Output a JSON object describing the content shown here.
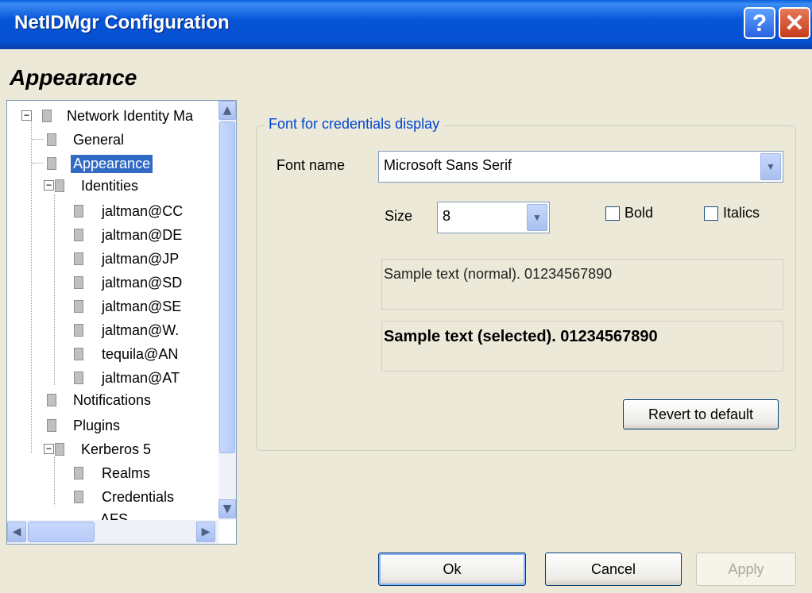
{
  "window": {
    "title": "NetIDMgr Configuration",
    "help_glyph": "?",
    "close_glyph": "✕"
  },
  "page_heading": "Appearance",
  "tree": {
    "root": "Network Identity Ma",
    "general": "General",
    "appearance": "Appearance",
    "identities": "Identities",
    "identity_items": [
      "jaltman@CC",
      "jaltman@DE",
      "jaltman@JP",
      "jaltman@SD",
      "jaltman@SE",
      "jaltman@W.",
      "tequila@AN",
      "jaltman@AT"
    ],
    "notifications": "Notifications",
    "plugins": "Plugins",
    "kerberos": "Kerberos 5",
    "realms": "Realms",
    "credentials": "Credentials",
    "afs_partial": "AFS",
    "selected": "Appearance"
  },
  "font_group": {
    "legend": "Font for credentials display",
    "font_name_label": "Font name",
    "font_name_value": "Microsoft Sans Serif",
    "size_label": "Size",
    "size_value": "8",
    "bold_label": "Bold",
    "bold_checked": false,
    "italics_label": "Italics",
    "italics_checked": false,
    "sample_normal": "Sample text (normal). 01234567890",
    "sample_selected": "Sample text (selected). 01234567890",
    "revert_label": "Revert to default"
  },
  "buttons": {
    "ok": "Ok",
    "cancel": "Cancel",
    "apply": "Apply",
    "apply_enabled": false
  },
  "colors": {
    "titlebar": "#0754d8",
    "selection": "#316ac5",
    "legend_text": "#0046d5",
    "dialog_bg": "#ece9d8"
  }
}
